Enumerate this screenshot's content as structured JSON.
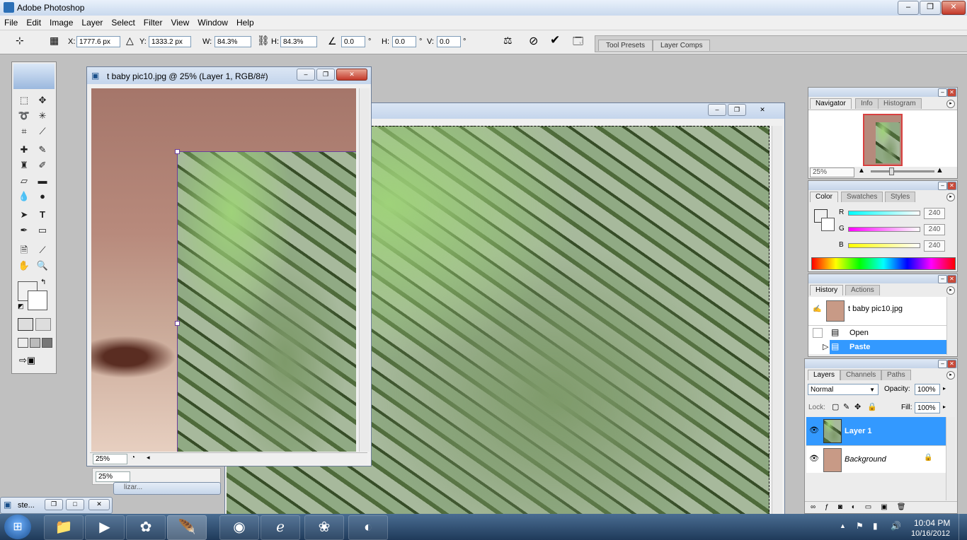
{
  "app": {
    "title": "Adobe Photoshop"
  },
  "menu": [
    "File",
    "Edit",
    "Image",
    "Layer",
    "Select",
    "Filter",
    "View",
    "Window",
    "Help"
  ],
  "options": {
    "x_label": "X:",
    "x_value": "1777.6 px",
    "y_label": "Y:",
    "y_value": "1333.2 px",
    "w_label": "W:",
    "w_value": "84.3%",
    "h_label": "H:",
    "h_value": "84.3%",
    "angle_value": "0.0",
    "hskew_label": "H:",
    "hskew_value": "0.0",
    "vskew_label": "V:",
    "vskew_value": "0.0",
    "degree": "°"
  },
  "panel_well": {
    "tabs": [
      "Tool Presets",
      "Layer Comps"
    ]
  },
  "doc_front": {
    "title": "t baby pic10.jpg @ 25% (Layer 1, RGB/8#)",
    "zoom": "25%"
  },
  "doc_back": {
    "zoom": "25%",
    "task_label": "lizar..."
  },
  "navigator": {
    "tabs": [
      "Navigator",
      "Info",
      "Histogram"
    ],
    "zoom": "25%"
  },
  "color": {
    "tabs": [
      "Color",
      "Swatches",
      "Styles"
    ],
    "r_label": "R",
    "g_label": "G",
    "b_label": "B",
    "r": "240",
    "g": "240",
    "b": "240"
  },
  "history": {
    "tabs": [
      "History",
      "Actions"
    ],
    "snapshot": "t baby pic10.jpg",
    "items": [
      {
        "label": "Open",
        "selected": false
      },
      {
        "label": "Paste",
        "selected": true
      }
    ]
  },
  "layers": {
    "tabs": [
      "Layers",
      "Channels",
      "Paths"
    ],
    "blend_mode": "Normal",
    "opacity_label": "Opacity:",
    "opacity": "100%",
    "lock_label": "Lock:",
    "fill_label": "Fill:",
    "fill": "100%",
    "items": [
      {
        "name": "Layer 1",
        "selected": true
      },
      {
        "name": "Background",
        "selected": false
      }
    ]
  },
  "minimized": {
    "label": "ste..."
  },
  "tray": {
    "time": "10:04 PM",
    "date": "10/16/2012"
  },
  "colors": {
    "selection": "#3399ff",
    "accent": "#2b6fb6",
    "taskbar": "#1f3a5a"
  }
}
